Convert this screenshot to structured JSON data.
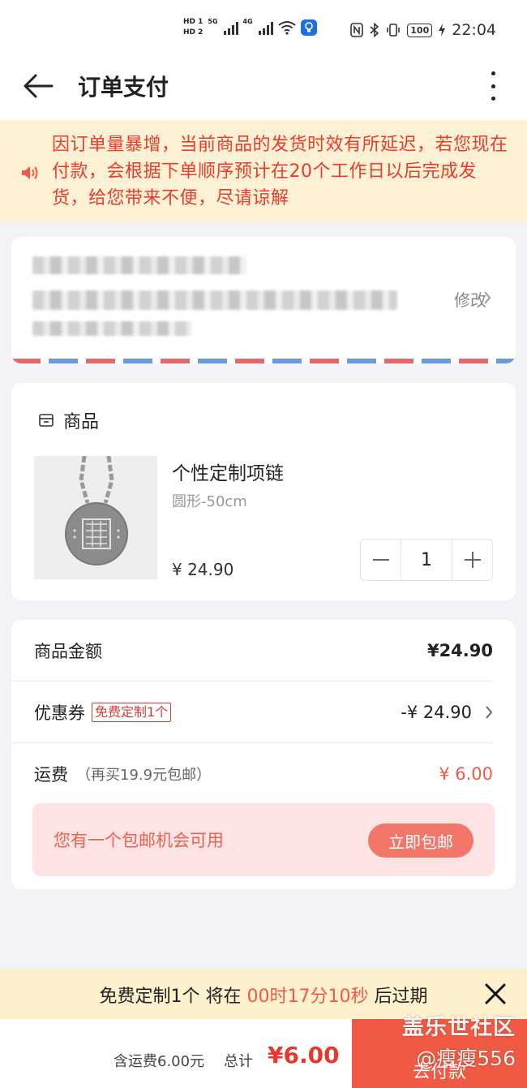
{
  "status_bar": {
    "sim1": "HD 1",
    "sim2": "HD 2",
    "net1": "5G",
    "net2": "4G",
    "battery": "100",
    "time": "22:04",
    "icons": [
      "nfc-icon",
      "bluetooth-icon",
      "vibrate-icon",
      "battery-icon",
      "charging-icon",
      "wifi-icon",
      "bulb-icon"
    ]
  },
  "header": {
    "title": "订单支付"
  },
  "notice": {
    "text": "因订单量暴增，当前商品的发货时效有所延迟，若您现在付款，会根据下单顺序预计在20个工作日以后完成发货，给您带来不便，尽请谅解"
  },
  "address": {
    "edit_label": "修改"
  },
  "product_section": {
    "title": "商品",
    "product_name": "个性定制项链",
    "spec": "圆形-50cm",
    "price": "¥ 24.90",
    "quantity": "1"
  },
  "summary": {
    "goods_amount_label": "商品金额",
    "goods_amount_value": "¥24.90",
    "coupon_label": "优惠券",
    "coupon_tag": "免费定制1个",
    "coupon_value": "-¥ 24.90",
    "shipping_label": "运费",
    "shipping_note": "（再买19.9元包邮）",
    "shipping_value": "¥ 6.00",
    "free_shipping_text": "您有一个包邮机会可用",
    "free_shipping_button": "立即包邮"
  },
  "countdown": {
    "prefix": "免费定制1个 将在 ",
    "time": "00时17分10秒",
    "suffix": " 后过期"
  },
  "bottom_bar": {
    "shipping_included": "含运费6.00元",
    "total_label": "总计",
    "total_amount": "¥6.00",
    "pay_button": "去付款"
  },
  "watermark": {
    "line1": "盖乐世社区",
    "line2": "@瘦瘦556"
  },
  "colors": {
    "accent_red": "#f05a42",
    "notice_bg": "#fdf1d5",
    "notice_text": "#e83c2c"
  }
}
